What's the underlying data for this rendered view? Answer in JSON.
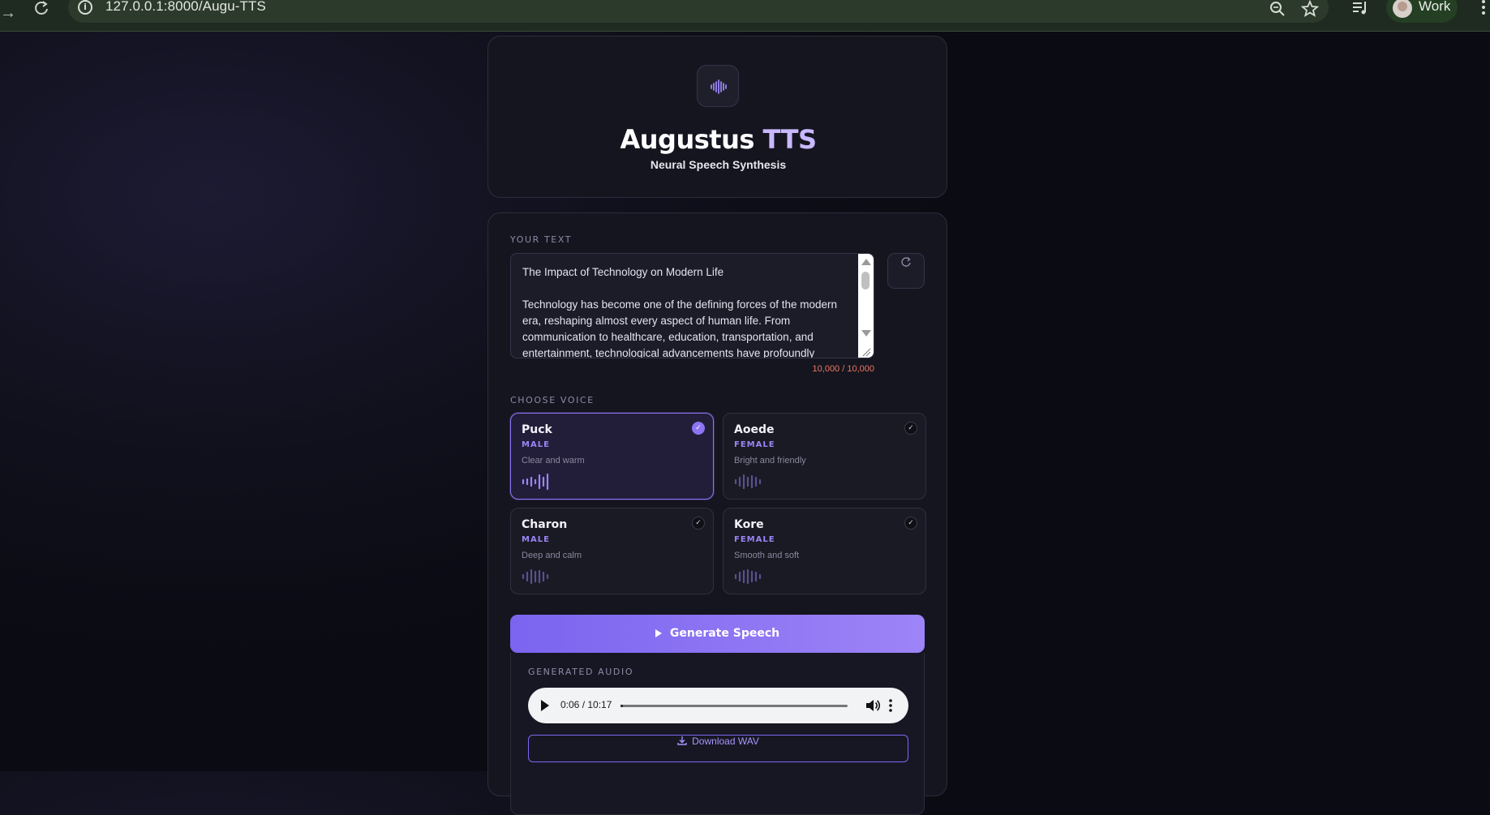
{
  "browser": {
    "url": "127.0.0.1:8000/Augu-TTS",
    "profile_label": "Work"
  },
  "app": {
    "title_main": "Augustus",
    "title_accent": "TTS",
    "subtitle": "Neural Speech Synthesis"
  },
  "text_section": {
    "label": "YOUR TEXT",
    "content": "The Impact of Technology on Modern Life\n\nTechnology has become one of the defining forces of the modern era, reshaping almost every aspect of human life. From communication to healthcare, education, transportation, and entertainment, technological advancements have profoundly",
    "counter": "10,000 / 10,000"
  },
  "voice_section": {
    "label": "CHOOSE VOICE",
    "voices": [
      {
        "name": "Puck",
        "gender": "MALE",
        "description": "Clear and warm",
        "selected": true
      },
      {
        "name": "Aoede",
        "gender": "FEMALE",
        "description": "Bright and friendly",
        "selected": false
      },
      {
        "name": "Charon",
        "gender": "MALE",
        "description": "Deep and calm",
        "selected": false
      },
      {
        "name": "Kore",
        "gender": "FEMALE",
        "description": "Smooth and soft",
        "selected": false
      }
    ]
  },
  "generate_label": "Generate Speech",
  "audio_section": {
    "label": "GENERATED AUDIO",
    "time": "0:06 / 10:17",
    "progress": 0.01,
    "download_label": "Download WAV"
  },
  "colors": {
    "accent": "#8d74f3",
    "counter": "#ee7660"
  }
}
